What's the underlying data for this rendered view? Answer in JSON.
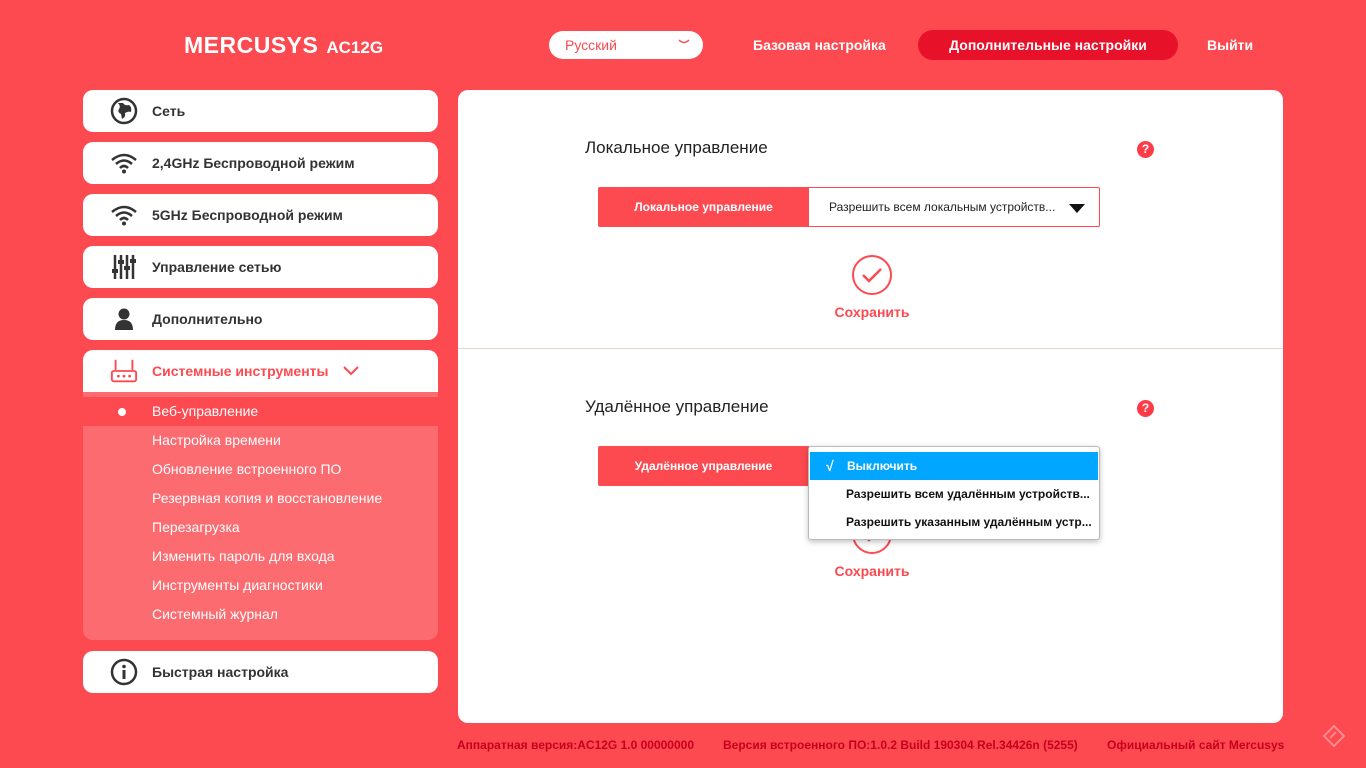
{
  "header": {
    "brand": "MERCUSYS",
    "model": "AC12G",
    "language": "Русский",
    "nav_basic": "Базовая настройка",
    "nav_advanced": "Дополнительные настройки",
    "nav_logout": "Выйти"
  },
  "sidebar": {
    "items": [
      {
        "label": "Сеть",
        "icon": "globe-icon"
      },
      {
        "label": "2,4GHz Беспроводной режим",
        "icon": "wifi-icon"
      },
      {
        "label": "5GHz Беспроводной режим",
        "icon": "wifi-icon"
      },
      {
        "label": "Управление сетью",
        "icon": "sliders-icon"
      },
      {
        "label": "Дополнительно",
        "icon": "user-icon"
      },
      {
        "label": "Системные инструменты",
        "icon": "router-icon"
      },
      {
        "label": "Быстрая настройка",
        "icon": "info-icon"
      }
    ],
    "submenu": [
      "Веб-управление",
      "Настройка времени",
      "Обновление встроенного ПО",
      "Резервная копия и восстановление",
      "Перезагрузка",
      "Изменить пароль для входа",
      "Инструменты диагностики",
      "Системный журнал"
    ]
  },
  "local": {
    "title": "Локальное управление",
    "field_label": "Локальное управление",
    "value": "Разрешить всем локальным устройств...",
    "save": "Сохранить"
  },
  "remote": {
    "title": "Удалённое управление",
    "field_label": "Удалённое управление",
    "options": [
      "Выключить",
      "Разрешить всем удалённым устройств...",
      "Разрешить указанным удалённым устр..."
    ],
    "check": "√",
    "save": "Сохранить"
  },
  "help_glyph": "?",
  "footer": {
    "hardware": "Аппаратная версия:AC12G 1.0 00000000",
    "firmware": "Версия встроенного ПО:1.0.2 Build 190304 Rel.34426n (5255)",
    "site": "Официальный сайт Mercusys"
  },
  "colors": {
    "background": "#fc4a50",
    "accent": "#e8112a",
    "submenu": "#fc6b70",
    "dropdown_selected": "#00a6ff"
  }
}
